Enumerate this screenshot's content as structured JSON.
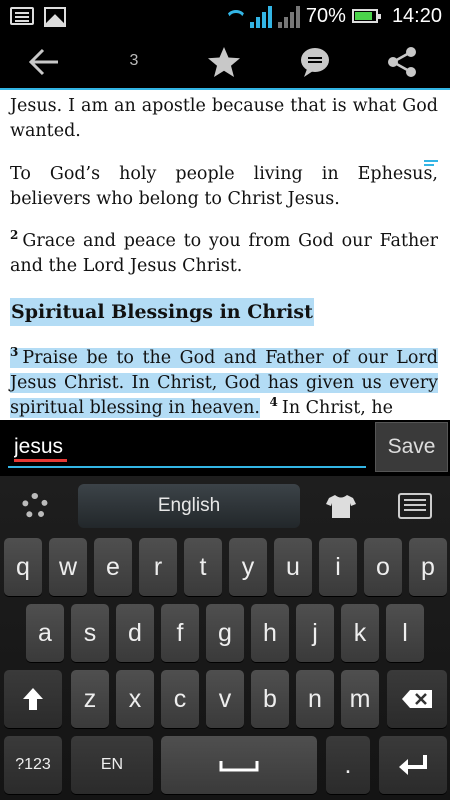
{
  "statusbar": {
    "battery_percent": "70%",
    "time": "14:20"
  },
  "toolbar": {
    "verse_count": "3"
  },
  "content": {
    "para1": "Jesus. I am an apostle because that is what God wanted.",
    "para2": "To God’s holy people living in Ephesus, believers who belong to Christ Jesus.",
    "para3_num": "2",
    "para3": "Grace and peace to you from God our Father and the Lord Jesus Christ.",
    "heading": "Spiritual Blessings in Christ",
    "para4_num": "3",
    "para4_hl": "Praise be to the God and Father of our Lord Jesus Christ. In Christ, God has given us every spiritual blessing in heaven.",
    "para4_num2": "4",
    "para4_rest": "In Christ, he"
  },
  "input": {
    "value": "jesus",
    "save_label": "Save"
  },
  "keyboard": {
    "language": "English",
    "row1": [
      "q",
      "w",
      "e",
      "r",
      "t",
      "y",
      "u",
      "i",
      "o",
      "p"
    ],
    "row2": [
      "a",
      "s",
      "d",
      "f",
      "g",
      "h",
      "j",
      "k",
      "l"
    ],
    "row3": [
      "z",
      "x",
      "c",
      "v",
      "b",
      "n",
      "m"
    ],
    "symbols_label": "?123",
    "lang_label": "EN",
    "period": "."
  }
}
